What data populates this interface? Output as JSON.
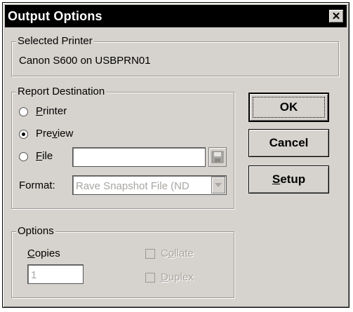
{
  "window": {
    "title": "Output Options"
  },
  "selected_printer": {
    "legend": "Selected Printer",
    "value": "Canon S600 on USBPRN01"
  },
  "report_destination": {
    "legend": "Report Destination",
    "options": [
      {
        "label": "Printer",
        "checked": false
      },
      {
        "label": "Preview",
        "checked": true
      },
      {
        "label": "File",
        "checked": false
      }
    ],
    "file_value": "",
    "format_label": "Format:",
    "format_value": "Rave Snapshot File (ND"
  },
  "options": {
    "legend": "Options",
    "copies_label": "Copies",
    "copies_value": "1",
    "collate_label": "Collate",
    "duplex_label": "Duplex"
  },
  "buttons": {
    "ok": "OK",
    "cancel": "Cancel",
    "setup": "Setup"
  }
}
